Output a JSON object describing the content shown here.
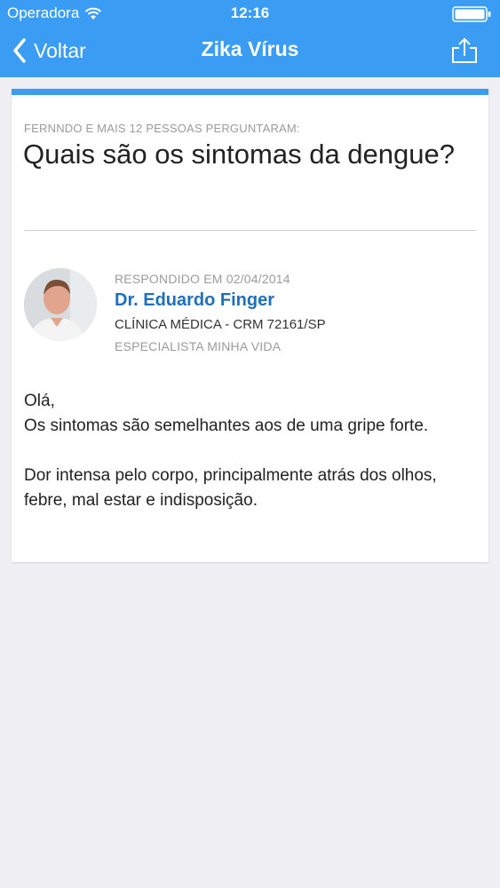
{
  "status_bar": {
    "carrier": "Operadora",
    "time": "12:16"
  },
  "nav": {
    "back_label": "Voltar",
    "title": "Zika Vírus"
  },
  "question": {
    "asked_by": "FERNNDO E MAIS 12 PESSOAS PERGUNTARAM:",
    "text": "Quais são os sintomas da dengue?"
  },
  "answer": {
    "answered_on": "RESPONDIDO EM 02/04/2014",
    "doctor_name": "Dr. Eduardo Finger",
    "doctor_crm": "CLÍNICA MÉDICA - CRM 72161/SP",
    "doctor_tag": "ESPECIALISTA MINHA VIDA",
    "paragraphs": [
      "Olá,",
      "Os sintomas são semelhantes aos de uma gripe forte.",
      "",
      "Dor intensa pelo corpo, principalmente atrás dos olhos, febre, mal estar e indisposição."
    ]
  },
  "icons": {
    "wifi": "wifi-icon",
    "battery": "battery-icon",
    "back": "chevron-left-icon",
    "share": "share-icon"
  },
  "colors": {
    "nav_background": "#3a9cf2",
    "accent_bar": "#3a9cf2",
    "doctor_name": "#1d6fbf",
    "page_background": "#efeff4"
  }
}
